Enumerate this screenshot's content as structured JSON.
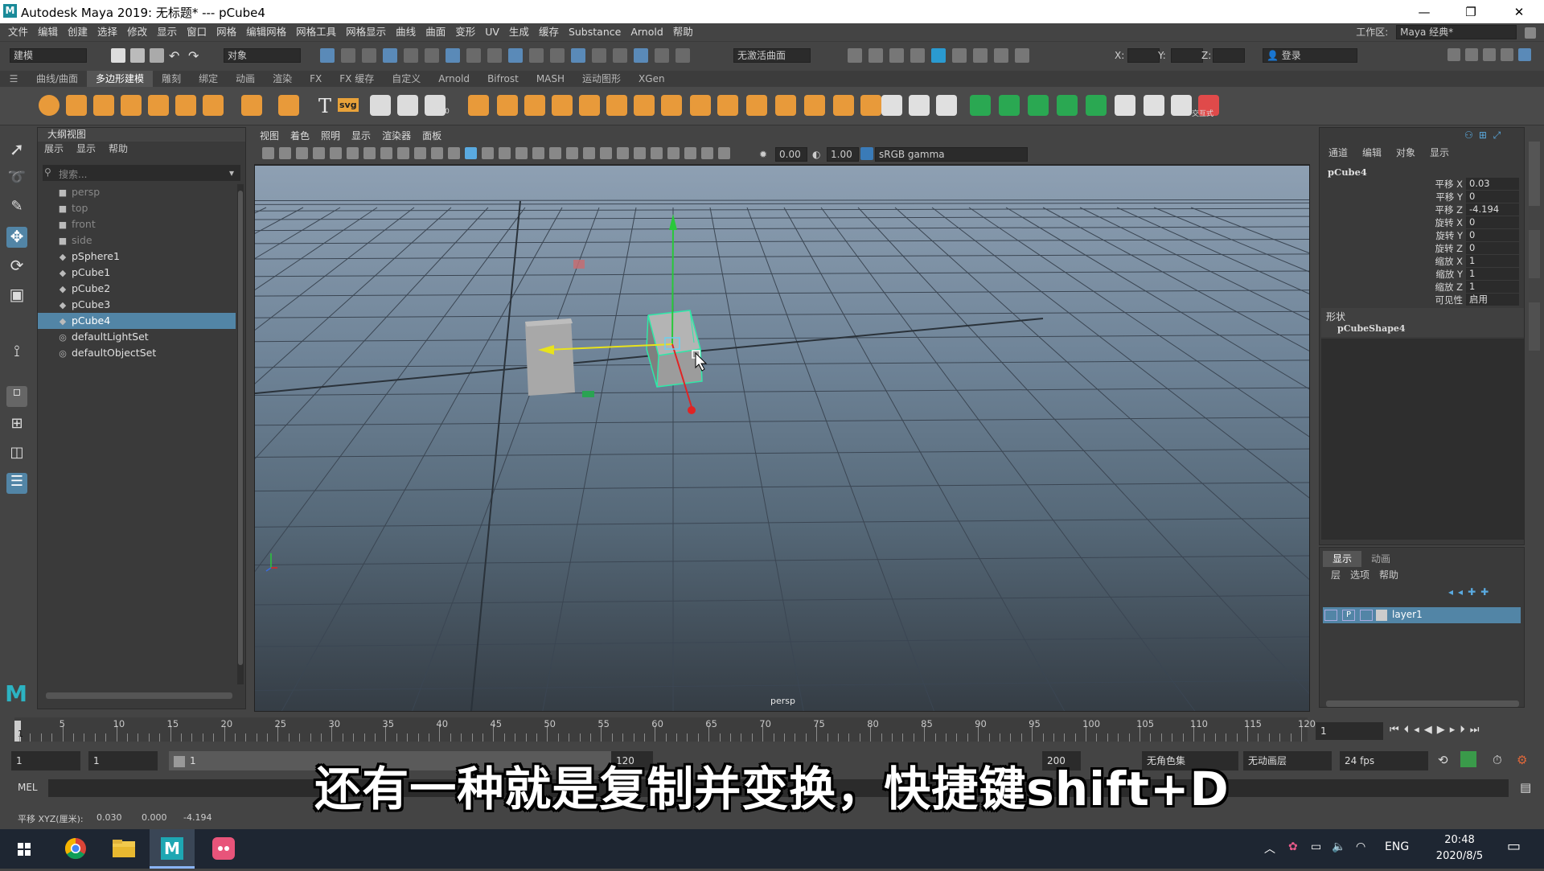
{
  "window": {
    "title": "Autodesk Maya 2019: 无标题*   ---   pCube4",
    "logo": "M",
    "minimize": "—",
    "maximize": "❐",
    "close": "✕"
  },
  "menubar": {
    "items": [
      "文件",
      "编辑",
      "创建",
      "选择",
      "修改",
      "显示",
      "窗口",
      "网格",
      "编辑网格",
      "网格工具",
      "网格显示",
      "曲线",
      "曲面",
      "变形",
      "UV",
      "生成",
      "缓存",
      "Substance",
      "Arnold",
      "帮助"
    ],
    "workspace_label": "工作区:",
    "workspace_value": "Maya 经典*"
  },
  "statusline": {
    "mode": "建模",
    "object_label": "对象",
    "live_surface": "无激活曲面",
    "x_label": "X:",
    "y_label": "Y:",
    "z_label": "Z:",
    "login": "登录"
  },
  "shelf_tabs": [
    "曲线/曲面",
    "多边形建模",
    "雕刻",
    "绑定",
    "动画",
    "渲染",
    "FX",
    "FX 缓存",
    "自定义",
    "Arnold",
    "Bifrost",
    "MASH",
    "运动图形",
    "XGen"
  ],
  "shelf_tabs_active": 1,
  "shelf_text": {
    "text_tool": "T",
    "svg_tool": "svg",
    "xyz_label": "0,0,0",
    "interactive": "交互式"
  },
  "outliner": {
    "title": "大纲视图",
    "menu": [
      "展示",
      "显示",
      "帮助"
    ],
    "search_placeholder": "搜索...",
    "items": [
      {
        "label": "persp",
        "type": "camera"
      },
      {
        "label": "top",
        "type": "camera"
      },
      {
        "label": "front",
        "type": "camera"
      },
      {
        "label": "side",
        "type": "camera"
      },
      {
        "label": "pSphere1",
        "type": "mesh"
      },
      {
        "label": "pCube1",
        "type": "mesh"
      },
      {
        "label": "pCube2",
        "type": "mesh"
      },
      {
        "label": "pCube3",
        "type": "mesh"
      },
      {
        "label": "pCube4",
        "type": "mesh",
        "selected": true
      },
      {
        "label": "defaultLightSet",
        "type": "set"
      },
      {
        "label": "defaultObjectSet",
        "type": "set"
      }
    ]
  },
  "viewport": {
    "menu": [
      "视图",
      "着色",
      "照明",
      "显示",
      "渲染器",
      "面板"
    ],
    "exposure": "0.00",
    "gamma": "1.00",
    "color_space": "sRGB gamma",
    "camera_label": "persp",
    "colors": {
      "sky_top": "#8ea0b3",
      "ground": "#353d45",
      "grid": "#3b4653",
      "select": "#2fe8a8"
    }
  },
  "channel_box": {
    "menu": [
      "通道",
      "编辑",
      "对象",
      "显示"
    ],
    "object": "pCube4",
    "channels": [
      {
        "label": "平移 X",
        "value": "0.03"
      },
      {
        "label": "平移 Y",
        "value": "0"
      },
      {
        "label": "平移 Z",
        "value": "-4.194"
      },
      {
        "label": "旋转 X",
        "value": "0"
      },
      {
        "label": "旋转 Y",
        "value": "0"
      },
      {
        "label": "旋转 Z",
        "value": "0"
      },
      {
        "label": "缩放 X",
        "value": "1"
      },
      {
        "label": "缩放 Y",
        "value": "1"
      },
      {
        "label": "缩放 Z",
        "value": "1"
      },
      {
        "label": "可见性",
        "value": "启用"
      }
    ],
    "shapes_label": "形状",
    "shape_name": "pCubeShape4"
  },
  "layer_editor": {
    "tabs": [
      "显示",
      "动画"
    ],
    "menu": [
      "层",
      "选项",
      "帮助"
    ],
    "layer_name": "layer1",
    "layer_p": "P"
  },
  "time_slider": {
    "ticks": [
      "5",
      "10",
      "15",
      "20",
      "25",
      "30",
      "35",
      "40",
      "45",
      "50",
      "55",
      "60",
      "65",
      "70",
      "75",
      "80",
      "85",
      "90",
      "95",
      "100",
      "105",
      "110",
      "115",
      "120"
    ],
    "first_tick": "1",
    "current_frame": "1"
  },
  "range_slider": {
    "start": "1",
    "anim_start": "1",
    "range_start": "1",
    "range_end": "120",
    "anim_end": "200",
    "char_set": "无角色集",
    "anim_layer": "无动画层",
    "fps": "24 fps"
  },
  "command_line": {
    "label": "MEL"
  },
  "help_line": {
    "label": "平移 XYZ(厘米):",
    "x": "0.030",
    "y": "0.000",
    "z": "-4.194"
  },
  "subtitle": "还有一种就是复制并变换，快捷键shift+D",
  "taskbar": {
    "lang": "ENG",
    "time": "20:48",
    "date": "2020/8/5"
  }
}
